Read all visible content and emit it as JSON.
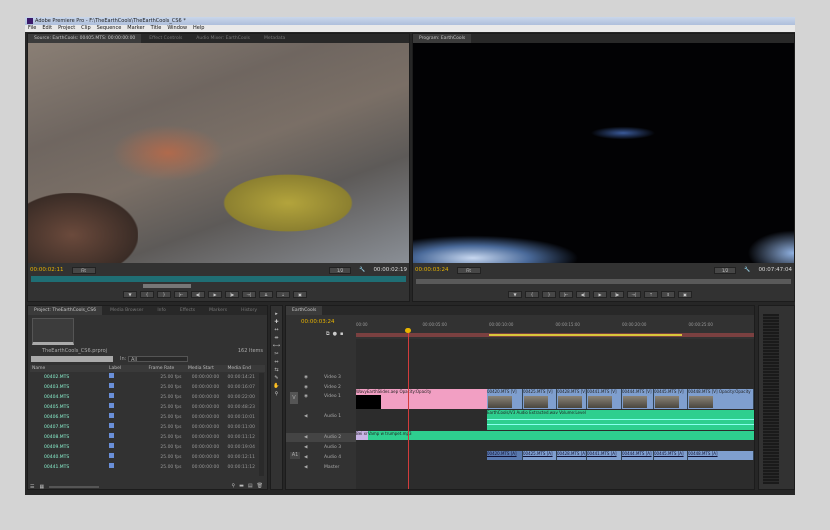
{
  "window": {
    "title": "Adobe Premiere Pro - F:\\TheEarthCools\\TheEarthCools_CS6 *"
  },
  "menu": [
    "File",
    "Edit",
    "Project",
    "Clip",
    "Sequence",
    "Marker",
    "Title",
    "Window",
    "Help"
  ],
  "source": {
    "tabs": [
      "Source: EarthCools: 00405.MTS: 00:00:00:00",
      "Effect Controls",
      "Audio Mixer: EarthCools",
      "Metadata"
    ],
    "timecode": "00:00:02:11",
    "duration": "00:00:02:19",
    "fit": "Fit",
    "quality": "1/2"
  },
  "program": {
    "tab": "Program: EarthCools",
    "timecode": "00:00:03:24",
    "duration": "00:07:47:04",
    "fit": "Fit",
    "quality": "1/2"
  },
  "transport_buttons": [
    "marker",
    "in",
    "out",
    "go-to-in",
    "step-back",
    "play",
    "step-forward",
    "go-to-out",
    "insert",
    "overwrite",
    "export-frame"
  ],
  "project": {
    "tabs": [
      "Project: TheEarthCools_CS6",
      "Media Browser",
      "Info",
      "Effects",
      "Markers",
      "History"
    ],
    "filename": "TheEarthCools_CS6.prproj",
    "item_count": "162 Items",
    "search_value": "",
    "in_label": "In:",
    "in_value": "All",
    "columns": [
      "Name",
      "Label",
      "Frame Rate",
      "Media Start",
      "Media End"
    ],
    "rows": [
      {
        "name": "00402.MTS",
        "fr": "25.00 fps",
        "ms": "00:00:00:00",
        "me": "00:00:14:21"
      },
      {
        "name": "00403.MTS",
        "fr": "25.00 fps",
        "ms": "00:00:00:00",
        "me": "00:00:16:07"
      },
      {
        "name": "00404.MTS",
        "fr": "25.00 fps",
        "ms": "00:00:00:00",
        "me": "00:00:22:00"
      },
      {
        "name": "00405.MTS",
        "fr": "25.00 fps",
        "ms": "00:00:00:00",
        "me": "00:00:48:23"
      },
      {
        "name": "00406.MTS",
        "fr": "25.00 fps",
        "ms": "00:00:00:00",
        "me": "00:00:10:01"
      },
      {
        "name": "00407.MTS",
        "fr": "25.00 fps",
        "ms": "00:00:00:00",
        "me": "00:00:11:00"
      },
      {
        "name": "00408.MTS",
        "fr": "25.00 fps",
        "ms": "00:00:00:00",
        "me": "00:00:11:12"
      },
      {
        "name": "00409.MTS",
        "fr": "25.00 fps",
        "ms": "00:00:00:00",
        "me": "00:00:19:04"
      },
      {
        "name": "00440.MTS",
        "fr": "25.00 fps",
        "ms": "00:00:00:00",
        "me": "00:00:12:11"
      },
      {
        "name": "00441.MTS",
        "fr": "25.00 fps",
        "ms": "00:00:00:00",
        "me": "00:00:11:12"
      }
    ],
    "label_color": "#6a8fd8"
  },
  "timeline": {
    "tab": "EarthCools",
    "timecode": "00:00:03:24",
    "ruler": [
      "00:00",
      "00:00:05:00",
      "00:00:10:00",
      "00:00:15:00",
      "00:00:20:00",
      "00:00:25:00"
    ],
    "tracks": [
      "Video 3",
      "Video 2",
      "Video 1",
      "Audio 1",
      "Audio 2",
      "Audio 3",
      "Audio 4",
      "Master"
    ],
    "v1_clips": [
      "WavyEarthSlides.aep",
      "Opacity:Opacity",
      "00420.MTS [V]",
      "00425.MTS [V]",
      "00428.MTS [V]",
      "00441.MTS [V]",
      "00444.MTS [V]",
      "00445.MTS [V]",
      "00448.MTS [V]",
      "Opacity:Opacity"
    ],
    "a1_clip": "EarthCools/V3 Audio Extracted.wav",
    "a1_fx": "Volume:Level",
    "a2_clips": [
      "Bei xr",
      "Vamp w trumpet.mp3"
    ],
    "a4_clips": [
      "00420.MTS [A]",
      "00425.MTS [A]",
      "00428.MTS [A]",
      "00441.MTS [A]",
      "00444.MTS [A]",
      "00445.MTS [A]",
      "00448.MTS [A]"
    ],
    "a1_target": "A1",
    "v_target": "V"
  },
  "colors": {
    "accent_timecode": "#e8b400",
    "video_clip": "#7f9fcf",
    "pink_clip": "#f29fc3",
    "audio_clip": "#2ecf8f",
    "playhead": "#d23c3c"
  }
}
